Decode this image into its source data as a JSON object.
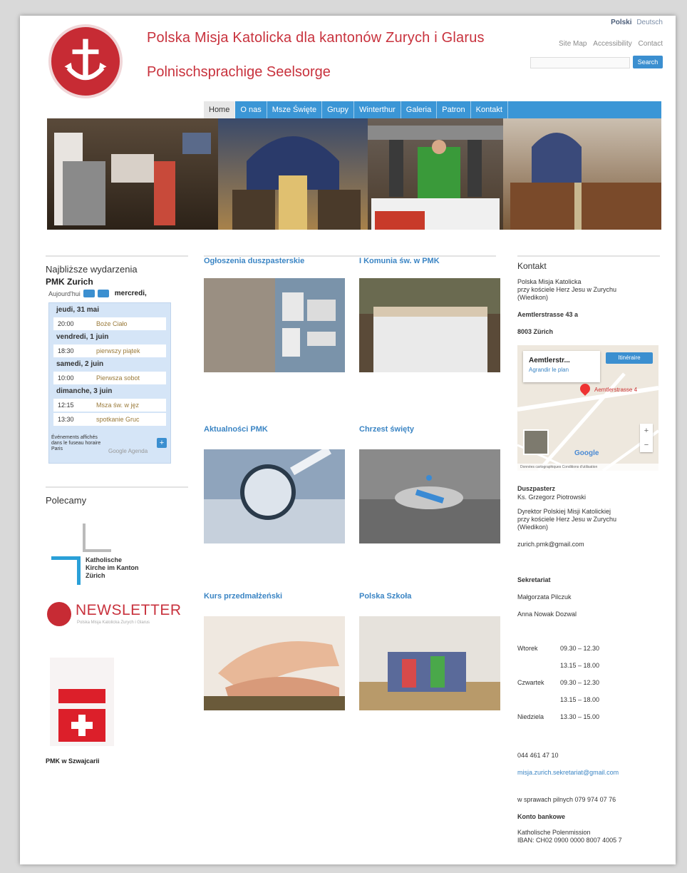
{
  "header": {
    "title": "Polska Misja Katolicka dla kantonów Zurych i Glarus",
    "subtitle": "Polnischsprachige Seelsorge",
    "lang_active": "Polski",
    "lang_other": "Deutsch",
    "links": [
      "Site Map",
      "Accessibility",
      "Contact"
    ],
    "search_button": "Search"
  },
  "nav": [
    "Home",
    "O nas",
    "Msze Święte",
    "Grupy",
    "Winterthur",
    "Galeria",
    "Patron",
    "Kontakt"
  ],
  "events": {
    "title": "Najbliższe wydarzenia",
    "subtitle": "PMK Zurich",
    "today_label": "Aujourd'hui",
    "current": "mercredi,",
    "days": [
      {
        "day": "jeudi, 31 mai",
        "items": [
          {
            "time": "20:00",
            "name": "Boże Ciało"
          }
        ]
      },
      {
        "day": "vendredi, 1 juin",
        "items": [
          {
            "time": "18:30",
            "name": "pierwszy piątek"
          }
        ]
      },
      {
        "day": "samedi, 2 juin",
        "items": [
          {
            "time": "10:00",
            "name": "Pierwsza sobot"
          }
        ]
      },
      {
        "day": "dimanche, 3 juin",
        "items": [
          {
            "time": "12:15",
            "name": "Msza św. w jęz"
          },
          {
            "time": "13:30",
            "name": "spotkanie Gruc"
          }
        ]
      }
    ],
    "footer_text": "Événements affichés dans le fuseau horaire Paris",
    "google_calendar": "Google Agenda"
  },
  "recommended": {
    "title": "Polecamy",
    "kkz": "Katholische Kirche im Kanton Zürich",
    "newsletter": "NEWSLETTER",
    "newsletter_sub": "Polska Misja Katolicka Zurych i Glarus",
    "pmk": "PMK w Szwajcarii"
  },
  "cards": [
    {
      "title": "Ogłoszenia duszpasterskie"
    },
    {
      "title": "I Komunia św. w PMK"
    },
    {
      "title": "Aktualności PMK"
    },
    {
      "title": "Chrzest święty"
    },
    {
      "title": "Kurs przedmałżeński"
    },
    {
      "title": "Polska Szkoła"
    }
  ],
  "contact": {
    "title": "Kontakt",
    "org1": "Polska Misja Katolicka",
    "org2": "przy kościele Herz Jesu w Zurychu",
    "org3": "(Wiedikon)",
    "street": "Aemtlerstrasse 43 a",
    "city": "8003 Zürich",
    "map_place": "Aemtlerstr...",
    "map_link": "Agrandir le plan",
    "map_directions": "Itinéraire",
    "map_addr": "Aemtlerstrasse 4",
    "map_attr": "Données cartographiques   Conditions d'utilisation",
    "pastor_h": "Duszpasterz",
    "pastor": "Ks. Grzegorz Piotrowski",
    "dir1": "Dyrektor Polskiej Misji Katolickiej",
    "dir2": "przy kościele Herz Jesu w Zurychu",
    "dir3": "(Wiedikon)",
    "email": "zurich.pmk@gmail.com",
    "sek_h": "Sekretariat",
    "sek1": "Małgorzata Pilczuk",
    "sek2": "Anna Nowak Dozwal",
    "hours": [
      {
        "day": "Wtorek",
        "time": "09.30 – 12.30"
      },
      {
        "day": "",
        "time": "13.15 – 18.00"
      },
      {
        "day": "Czwartek",
        "time": "09.30 – 12.30"
      },
      {
        "day": "",
        "time": "13.15 – 18.00"
      },
      {
        "day": "Niedziela",
        "time": "13.30 – 15.00"
      }
    ],
    "phone": "044 461 47 10",
    "sek_email": "misja.zurich.sekretariat@gmail.com",
    "urgent": "w sprawach pilnych 079 974 07 76",
    "bank_h": "Konto bankowe",
    "bank1": "Katholische Polenmission",
    "bank2": "IBAN: CH02 0900 0000 8007 4005 7"
  }
}
